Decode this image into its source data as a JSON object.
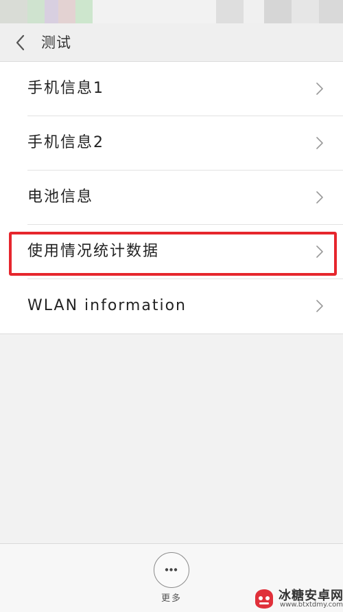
{
  "header": {
    "title": "测试"
  },
  "list": {
    "items": [
      {
        "label": "手机信息1"
      },
      {
        "label": "手机信息2"
      },
      {
        "label": "电池信息"
      },
      {
        "label": "使用情况统计数据"
      },
      {
        "label": "WLAN information"
      }
    ]
  },
  "bottombar": {
    "more_label": "更多"
  },
  "watermark": {
    "title": "冰糖安卓网",
    "url": "www.btxtdmy.com"
  },
  "colors": {
    "highlight": "#e6262d",
    "background": "#f2f2f2",
    "list_background": "#ffffff"
  }
}
